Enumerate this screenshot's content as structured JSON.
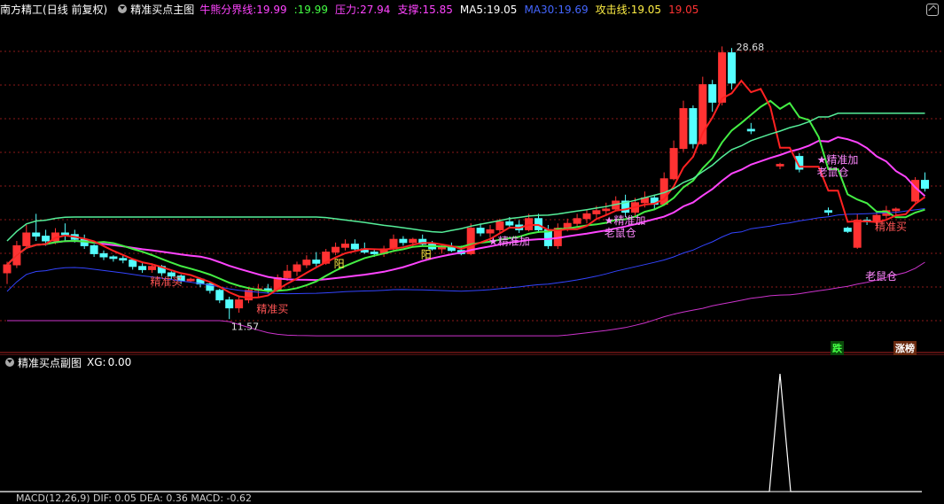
{
  "header": {
    "stock_name": "南方精工",
    "period": "(日线 前复权)",
    "indicator_name": "精准买点主图",
    "items": [
      {
        "label": "牛熊分界线:",
        "value": "19.99",
        "color": "#ff44ff"
      },
      {
        "label": ":",
        "value": "19.99",
        "color": "#44ff44"
      },
      {
        "label": "压力:",
        "value": "27.94",
        "color": "#ff44ff"
      },
      {
        "label": "支撑:",
        "value": "15.85",
        "color": "#ff44ff"
      },
      {
        "label": "MA5:",
        "value": "19.05",
        "color": "#ffffff"
      },
      {
        "label": "MA30:",
        "value": "19.69",
        "color": "#4466ff"
      },
      {
        "label": "攻击线:",
        "value": "19.05",
        "color": "#ffee44"
      },
      {
        "label": "",
        "value": "19.05",
        "color": "#ff3333"
      }
    ]
  },
  "price_labels": {
    "high": "28.68",
    "low": "11.57"
  },
  "signals": {
    "buy": "精准买",
    "add": "精准加",
    "mouse": "老鼠仓",
    "yang": "阳"
  },
  "tags": {
    "fall": "跌",
    "rise": "涨榜"
  },
  "sub_header": {
    "name": "精准买点副图",
    "xg_label": "XG:",
    "xg_value": "0.00"
  },
  "bottom_header": {
    "text": "MACD(12,26,9)  DIF: 0.05  DEA: 0.36  MACD: -0.62"
  },
  "colors": {
    "up": "#ff3232",
    "down": "#54ffff",
    "grid": "#8b1a1a"
  },
  "chart_data": {
    "type": "candlestick",
    "y_range": [
      10.5,
      30.5
    ],
    "candles": [
      [
        14.5,
        15.2,
        13.8,
        15.0
      ],
      [
        15.0,
        16.5,
        14.8,
        16.2
      ],
      [
        16.2,
        17.5,
        16.0,
        17.0
      ],
      [
        17.0,
        18.2,
        16.5,
        16.8
      ],
      [
        16.8,
        17.2,
        16.2,
        16.5
      ],
      [
        16.5,
        17.3,
        16.3,
        17.0
      ],
      [
        17.0,
        17.6,
        16.5,
        16.9
      ],
      [
        16.9,
        17.2,
        16.4,
        16.6
      ],
      [
        16.6,
        16.9,
        16.0,
        16.2
      ],
      [
        16.2,
        16.3,
        15.5,
        15.7
      ],
      [
        15.7,
        15.9,
        15.3,
        15.5
      ],
      [
        15.5,
        15.6,
        15.2,
        15.4
      ],
      [
        15.4,
        15.6,
        15.1,
        15.3
      ],
      [
        15.3,
        15.4,
        14.7,
        14.9
      ],
      [
        14.9,
        15.1,
        14.5,
        14.7
      ],
      [
        14.7,
        15.1,
        14.5,
        14.9
      ],
      [
        14.9,
        15.0,
        14.3,
        14.5
      ],
      [
        14.5,
        14.6,
        14.1,
        14.3
      ],
      [
        14.3,
        14.4,
        13.8,
        14.0
      ],
      [
        14.0,
        14.2,
        13.9,
        14.1
      ],
      [
        14.1,
        14.2,
        13.6,
        13.8
      ],
      [
        13.8,
        13.9,
        13.2,
        13.4
      ],
      [
        13.4,
        13.5,
        12.6,
        12.8
      ],
      [
        12.8,
        13.0,
        11.6,
        12.3
      ],
      [
        12.3,
        13.0,
        12.0,
        12.8
      ],
      [
        12.8,
        13.6,
        12.6,
        13.4
      ],
      [
        13.4,
        13.8,
        13.0,
        13.5
      ],
      [
        13.5,
        13.8,
        13.2,
        13.4
      ],
      [
        13.4,
        14.4,
        13.3,
        14.2
      ],
      [
        14.2,
        15.0,
        14.0,
        14.6
      ],
      [
        14.6,
        15.2,
        14.3,
        15.0
      ],
      [
        15.0,
        15.6,
        14.8,
        15.3
      ],
      [
        15.3,
        15.8,
        14.9,
        15.1
      ],
      [
        15.1,
        16.0,
        15.0,
        15.8
      ],
      [
        15.8,
        16.4,
        15.6,
        16.1
      ],
      [
        16.1,
        16.6,
        15.9,
        16.3
      ],
      [
        16.3,
        16.6,
        15.9,
        16.0
      ],
      [
        16.0,
        16.4,
        15.7,
        15.8
      ],
      [
        15.8,
        16.0,
        15.5,
        15.7
      ],
      [
        15.7,
        16.2,
        15.5,
        16.0
      ],
      [
        16.0,
        16.9,
        15.8,
        16.6
      ],
      [
        16.6,
        16.8,
        16.2,
        16.4
      ],
      [
        16.4,
        16.7,
        16.1,
        16.6
      ],
      [
        16.6,
        16.9,
        16.2,
        16.3
      ],
      [
        16.3,
        16.5,
        15.9,
        16.0
      ],
      [
        16.0,
        16.3,
        15.7,
        16.1
      ],
      [
        16.1,
        16.4,
        15.8,
        15.9
      ],
      [
        15.9,
        16.2,
        15.6,
        15.7
      ],
      [
        15.7,
        17.6,
        15.6,
        17.3
      ],
      [
        17.3,
        17.6,
        16.8,
        17.0
      ],
      [
        17.0,
        17.5,
        16.7,
        17.2
      ],
      [
        17.2,
        17.9,
        17.0,
        17.7
      ],
      [
        17.7,
        18.0,
        17.3,
        17.5
      ],
      [
        17.5,
        17.8,
        17.0,
        17.2
      ],
      [
        17.2,
        18.2,
        17.1,
        17.9
      ],
      [
        17.9,
        18.2,
        17.0,
        17.2
      ],
      [
        17.2,
        17.5,
        16.0,
        16.2
      ],
      [
        16.2,
        17.6,
        16.0,
        17.3
      ],
      [
        17.3,
        17.9,
        17.1,
        17.6
      ],
      [
        17.6,
        18.2,
        17.4,
        17.9
      ],
      [
        17.9,
        18.5,
        17.6,
        18.2
      ],
      [
        18.2,
        18.7,
        17.9,
        18.4
      ],
      [
        18.4,
        18.9,
        18.1,
        18.5
      ],
      [
        18.5,
        19.3,
        18.4,
        19.0
      ],
      [
        19.0,
        19.4,
        18.0,
        18.3
      ],
      [
        18.3,
        19.2,
        18.1,
        18.9
      ],
      [
        18.9,
        19.6,
        18.6,
        19.2
      ],
      [
        19.2,
        19.4,
        18.5,
        18.8
      ],
      [
        18.8,
        20.8,
        18.7,
        20.4
      ],
      [
        20.4,
        22.8,
        20.3,
        22.3
      ],
      [
        22.3,
        25.3,
        22.1,
        24.8
      ],
      [
        24.8,
        25.0,
        22.3,
        22.6
      ],
      [
        22.6,
        26.8,
        22.5,
        26.3
      ],
      [
        26.3,
        26.6,
        24.6,
        25.2
      ],
      [
        25.2,
        28.7,
        25.0,
        28.3
      ],
      [
        28.3,
        28.6,
        26.0,
        26.4
      ],
      [
        null,
        null,
        null,
        null
      ],
      [
        23.5,
        23.9,
        23.2,
        23.4
      ],
      [
        null,
        null,
        null,
        null
      ],
      [
        null,
        null,
        null,
        null
      ],
      [
        21.2,
        21.4,
        21.0,
        21.3
      ],
      [
        null,
        null,
        null,
        null
      ],
      [
        21.8,
        22.0,
        20.8,
        21.0
      ],
      [
        null,
        null,
        null,
        null
      ],
      [
        null,
        null,
        null,
        null
      ],
      [
        18.4,
        18.6,
        18.1,
        18.3
      ],
      [
        null,
        null,
        null,
        null
      ],
      [
        17.3,
        17.4,
        17.0,
        17.1
      ],
      [
        16.1,
        18.2,
        16.0,
        17.8
      ],
      [
        17.8,
        18.0,
        17.5,
        17.7
      ],
      [
        17.7,
        18.4,
        17.5,
        18.1
      ],
      [
        18.1,
        18.7,
        17.9,
        18.4
      ],
      [
        18.4,
        18.6,
        18.1,
        18.5
      ],
      [
        null,
        null,
        null,
        null
      ],
      [
        19.0,
        20.5,
        18.9,
        20.3
      ],
      [
        20.3,
        20.8,
        19.6,
        19.8
      ]
    ],
    "xg_spike_index": 80
  }
}
